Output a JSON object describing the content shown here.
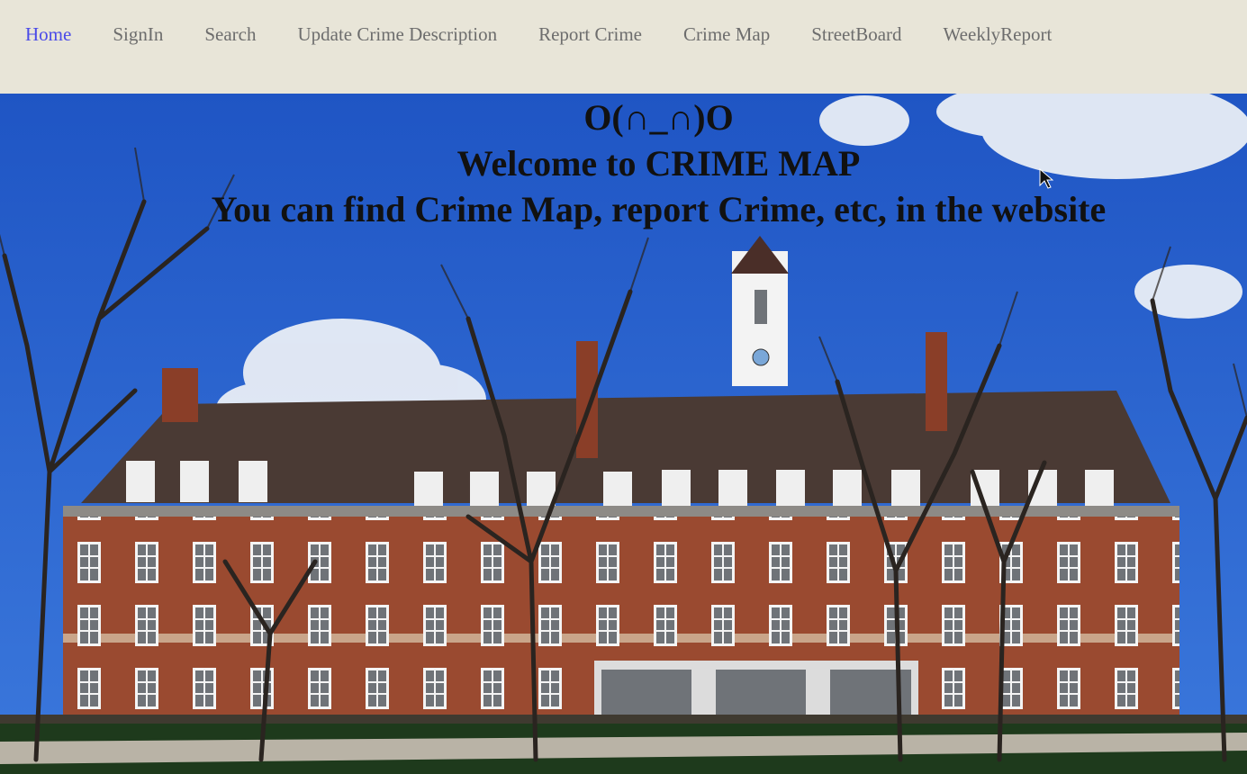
{
  "nav": {
    "items": [
      {
        "label": "Home",
        "active": true
      },
      {
        "label": "SignIn",
        "active": false
      },
      {
        "label": "Search",
        "active": false
      },
      {
        "label": "Update Crime Description",
        "active": false
      },
      {
        "label": "Report Crime",
        "active": false
      },
      {
        "label": "Crime Map",
        "active": false
      },
      {
        "label": "StreetBoard",
        "active": false
      },
      {
        "label": "WeeklyReport",
        "active": false
      }
    ]
  },
  "hero": {
    "emoticon": "O(∩_∩)O",
    "welcome": "Welcome to CRIME MAP",
    "tagline": "You can find Crime Map, report Crime, etc, in the website"
  },
  "colors": {
    "nav_bg": "#e8e5d8",
    "nav_active": "#4a4ae8",
    "nav_text": "#6d6d6d",
    "sky": "#2a63cf",
    "brick": "#9a4a30",
    "roof": "#4a3a34",
    "lawn": "#1e3a1c"
  }
}
